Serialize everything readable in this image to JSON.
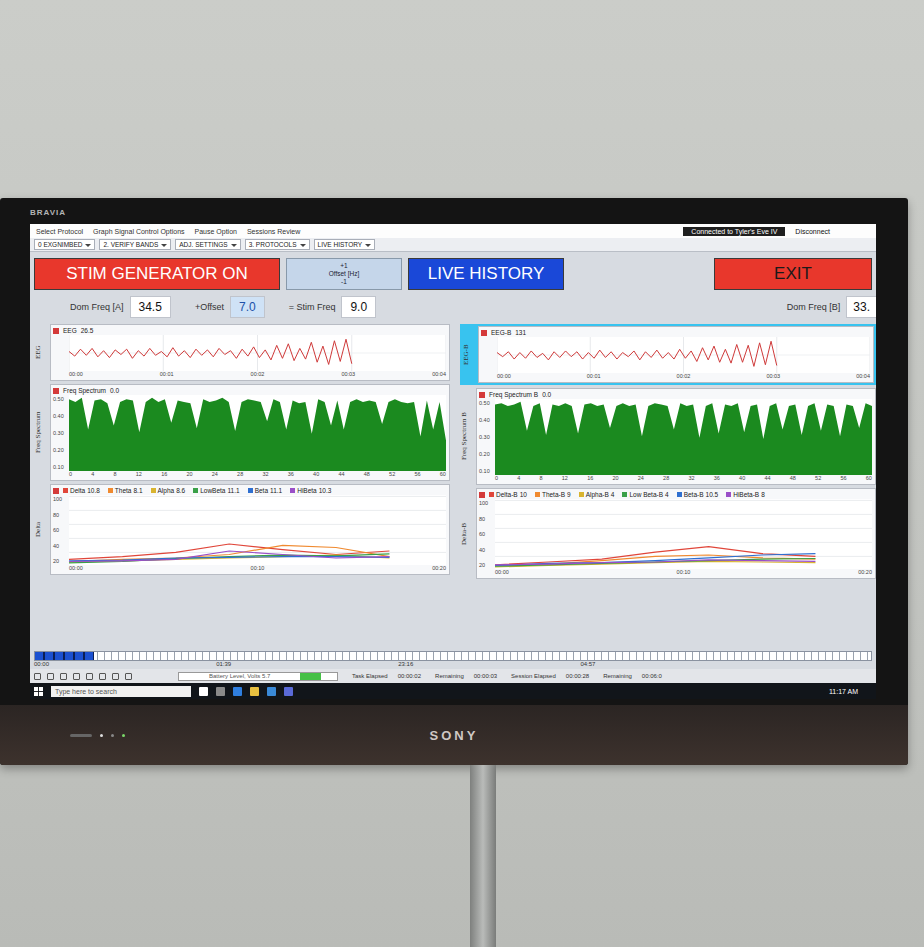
{
  "tv": {
    "top_brand": "BRAVIA",
    "bottom_brand": "SONY"
  },
  "window": {
    "title": "Connected to Tyler's Eve IV",
    "disconnect": "Disconnect"
  },
  "menu": [
    "Select Protocol",
    "Graph Signal Control Options",
    "Pause Option",
    "Sessions Review"
  ],
  "toolbar": [
    "0 EXGNIMBED",
    "2. VERIFY BANDS",
    "ADJ. SETTINGS",
    "3. PROTOCOLS",
    "LIVE HISTORY"
  ],
  "controls": {
    "stim": {
      "label": "STIM GENERATOR ON",
      "on": true
    },
    "offset": {
      "up": "+1",
      "label": "Offset [Hz]",
      "down": "-1"
    },
    "live_history": "LIVE HISTORY",
    "exit": "EXIT"
  },
  "frequencies": {
    "dom_a_label": "Dom Freq [A]",
    "dom_a": "34.5",
    "offset_label": "+Offset",
    "offset": "7.0",
    "stim_label": "= Stim Freq",
    "stim": "9.0",
    "dom_b_label": "Dom Freq [B]",
    "dom_b": "33."
  },
  "panels": [
    {
      "eeg_axis_label": "EEG",
      "spectrum_axis_label": "Freq Spectrum",
      "bands_axis_label": "Delta",
      "eeg": {
        "title": "EEG",
        "value": "26.5",
        "selected": false,
        "level": 0.75,
        "x_ticks": [
          "00:00",
          "00:01",
          "00:02",
          "00:03",
          "00:04"
        ],
        "values": [
          2,
          -4,
          5,
          -3,
          6,
          -5,
          3,
          -6,
          4,
          -2,
          5,
          -7,
          3,
          -4,
          6,
          -3,
          2,
          -5,
          7,
          -4,
          3,
          -6,
          5,
          -3,
          4,
          -5,
          6,
          -2,
          3,
          -7,
          5,
          -4,
          8,
          -6,
          4,
          -9,
          10,
          -7,
          12,
          -10,
          6,
          -8,
          14,
          -12,
          9,
          -15,
          16,
          -11,
          18,
          -14
        ]
      },
      "spectrum": {
        "title": "Freq Spectrum",
        "value": "0.0",
        "y_ticks": [
          "0.50",
          "0.40",
          "0.30",
          "0.20",
          "0.10"
        ],
        "x_ticks": [
          "0",
          "4",
          "8",
          "12",
          "16",
          "20",
          "24",
          "28",
          "32",
          "36",
          "40",
          "44",
          "48",
          "52",
          "56",
          "60"
        ],
        "values": [
          0.52,
          0.5,
          0.53,
          0.3,
          0.51,
          0.52,
          0.49,
          0.33,
          0.5,
          0.52,
          0.51,
          0.28,
          0.5,
          0.53,
          0.5,
          0.52,
          0.35,
          0.51,
          0.5,
          0.49,
          0.31,
          0.52,
          0.5,
          0.51,
          0.53,
          0.5,
          0.29,
          0.5,
          0.52,
          0.51,
          0.5,
          0.36,
          0.52,
          0.5,
          0.3,
          0.51,
          0.49,
          0.5,
          0.27,
          0.52,
          0.5,
          0.33,
          0.51,
          0.3,
          0.5,
          0.52,
          0.5,
          0.51,
          0.5,
          0.34,
          0.5,
          0.52,
          0.5,
          0.49,
          0.5,
          0.25,
          0.51,
          0.3,
          0.5,
          0.22
        ]
      },
      "bands": {
        "y_ticks": [
          "100",
          "80",
          "60",
          "40",
          "20"
        ],
        "x_ticks": [
          "00:00",
          "00:10",
          "00:20"
        ],
        "series": [
          {
            "name": "Delta",
            "value": "10.8",
            "color": "#e0463a",
            "values": [
              8,
              12,
              18,
              30,
              22,
              15,
              20
            ]
          },
          {
            "name": "Theta",
            "value": "8.1",
            "color": "#f08a30",
            "values": [
              5,
              8,
              10,
              15,
              28,
              25,
              12
            ]
          },
          {
            "name": "Alpha",
            "value": "8.6",
            "color": "#d9b430",
            "values": [
              4,
              6,
              8,
              10,
              12,
              14,
              10
            ]
          },
          {
            "name": "LowBeta",
            "value": "11.1",
            "color": "#3aa048",
            "values": [
              3,
              5,
              9,
              12,
              14,
              13,
              16
            ]
          },
          {
            "name": "Beta",
            "value": "11.1",
            "color": "#2f6fd0",
            "values": [
              6,
              7,
              10,
              11,
              12,
              12,
              11
            ]
          },
          {
            "name": "HiBeta",
            "value": "10.3",
            "color": "#9a4fc8",
            "values": [
              5,
              6,
              8,
              20,
              15,
              10,
              12
            ]
          }
        ]
      }
    },
    {
      "eeg_axis_label": "EEG-B",
      "spectrum_axis_label": "Freq Spectrum B",
      "bands_axis_label": "Delta-B",
      "eeg": {
        "title": "EEG-B",
        "value": "131",
        "selected": true,
        "level": 0.75,
        "x_ticks": [
          "00:00",
          "00:01",
          "00:02",
          "00:03",
          "00:04"
        ],
        "values": [
          3,
          -2,
          4,
          -5,
          3,
          -4,
          5,
          -3,
          2,
          -6,
          4,
          -3,
          5,
          -2,
          4,
          -5,
          3,
          -4,
          6,
          -3,
          4,
          -5,
          3,
          -2,
          5,
          -6,
          4,
          -3,
          6,
          -4,
          3,
          -5,
          7,
          -4,
          5,
          -8,
          9,
          -6,
          11,
          -9,
          7,
          -10,
          13,
          -9,
          12,
          -14,
          15,
          -12,
          17,
          -13
        ]
      },
      "spectrum": {
        "title": "Freq Spectrum B",
        "value": "0.0",
        "y_ticks": [
          "0.50",
          "0.40",
          "0.30",
          "0.20",
          "0.10"
        ],
        "x_ticks": [
          "0",
          "4",
          "8",
          "12",
          "16",
          "20",
          "24",
          "28",
          "32",
          "36",
          "40",
          "44",
          "48",
          "52",
          "56",
          "60"
        ],
        "values": [
          0.51,
          0.52,
          0.5,
          0.51,
          0.53,
          0.32,
          0.5,
          0.52,
          0.29,
          0.51,
          0.5,
          0.52,
          0.5,
          0.3,
          0.51,
          0.52,
          0.5,
          0.51,
          0.34,
          0.5,
          0.52,
          0.5,
          0.51,
          0.28,
          0.5,
          0.52,
          0.51,
          0.5,
          0.33,
          0.52,
          0.5,
          0.51,
          0.27,
          0.5,
          0.52,
          0.3,
          0.51,
          0.5,
          0.52,
          0.31,
          0.5,
          0.51,
          0.26,
          0.5,
          0.52,
          0.33,
          0.5,
          0.51,
          0.29,
          0.5,
          0.52,
          0.32,
          0.51,
          0.5,
          0.28,
          0.51,
          0.5,
          0.34,
          0.52,
          0.5
        ]
      },
      "bands": {
        "y_ticks": [
          "100",
          "80",
          "60",
          "40",
          "20"
        ],
        "x_ticks": [
          "00:00",
          "00:10",
          "00:20"
        ],
        "series": [
          {
            "name": "Delta-B",
            "value": "10",
            "color": "#e0463a",
            "values": [
              6,
              10,
              14,
              24,
              32,
              22,
              18
            ]
          },
          {
            "name": "Theta-B",
            "value": "9",
            "color": "#f08a30",
            "values": [
              5,
              7,
              12,
              18,
              20,
              16,
              14
            ]
          },
          {
            "name": "Alpha-B",
            "value": "4",
            "color": "#d9b430",
            "values": [
              3,
              5,
              7,
              9,
              11,
              10,
              9
            ]
          },
          {
            "name": "Low Beta-B",
            "value": "4",
            "color": "#3aa048",
            "values": [
              4,
              6,
              8,
              10,
              12,
              14,
              15
            ]
          },
          {
            "name": "Beta-B",
            "value": "10.5",
            "color": "#2f6fd0",
            "values": [
              5,
              8,
              9,
              12,
              16,
              20,
              22
            ]
          },
          {
            "name": "HiBeta-B",
            "value": "8",
            "color": "#9a4fc8",
            "values": [
              6,
              7,
              9,
              10,
              13,
              12,
              11
            ]
          }
        ]
      }
    }
  ],
  "timeline": {
    "labels": [
      "00:00",
      "01:39",
      "23:16",
      "04:57"
    ],
    "level": 0.07
  },
  "status": {
    "battery_label": "Battery Level, Volts",
    "battery": "5.7",
    "battery_level": 0.9,
    "fields": [
      {
        "label": "Task Elapsed",
        "value": "00:00:02"
      },
      {
        "label": "Remaining",
        "value": "00:00:03"
      },
      {
        "label": "Session Elapsed",
        "value": "00:00:28"
      },
      {
        "label": "Remaining",
        "value": "00:06:0"
      }
    ]
  },
  "taskbar": {
    "search": "Type here to search",
    "time": "11:17 AM"
  }
}
